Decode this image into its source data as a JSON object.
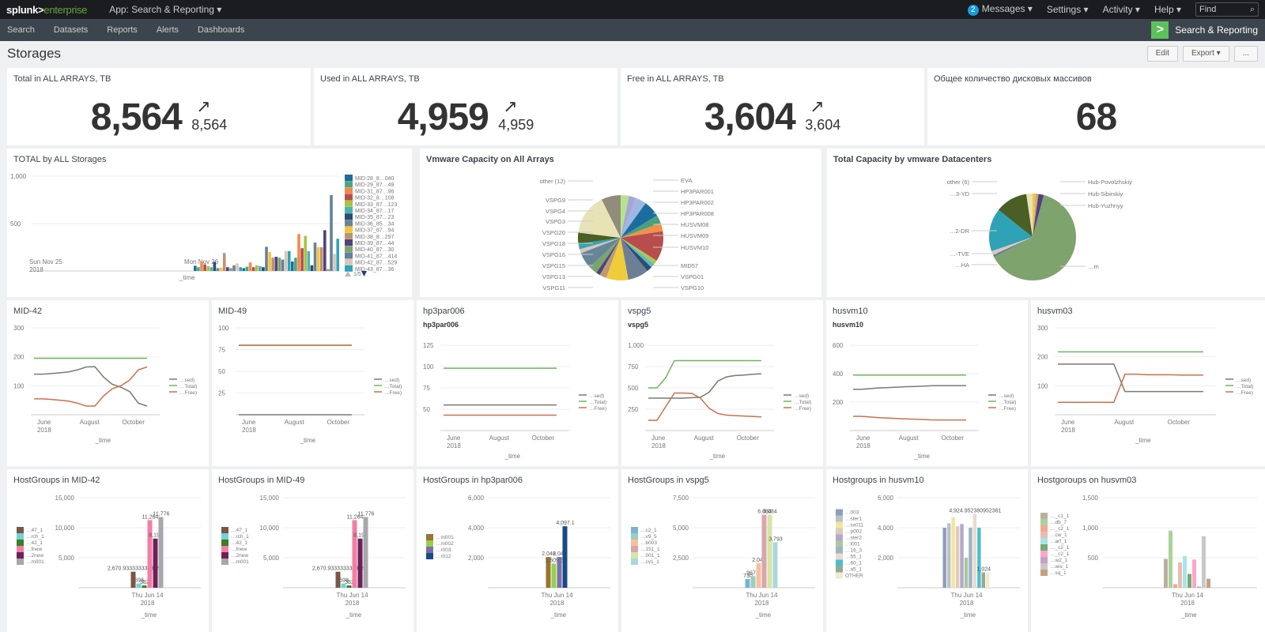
{
  "topbar": {
    "logo_a": "splunk>",
    "logo_b": "enterprise",
    "app_menu": "App: Search & Reporting ▾",
    "messages_count": "2",
    "messages": "Messages ▾",
    "settings": "Settings ▾",
    "activity": "Activity ▾",
    "help": "Help ▾",
    "find_placeholder": "Find",
    "find_icon": "search-icon"
  },
  "nav": {
    "items": [
      "Search",
      "Datasets",
      "Reports",
      "Alerts",
      "Dashboards"
    ],
    "app_title": "Search & Reporting",
    "app_icon": ">"
  },
  "page": {
    "title": "Storages",
    "edit": "Edit",
    "export": "Export ▾",
    "more": "..."
  },
  "singles": [
    {
      "title": "Total in ALL ARRAYS, TB",
      "value": "8,564",
      "delta": "8,564",
      "trend": "↗"
    },
    {
      "title": "Used in ALL ARRAYS, TB",
      "value": "4,959",
      "delta": "4,959",
      "trend": "↗"
    },
    {
      "title": "Free in ALL ARRAYS, TB",
      "value": "3,604",
      "delta": "3,604",
      "trend": "↗"
    },
    {
      "title": "Общее количество дисковых массивов",
      "value": "68"
    }
  ],
  "chart_data": [
    {
      "id": "total-by-all",
      "type": "bar",
      "title": "TOTAL by ALL Storages",
      "xlabel": "_time",
      "ylim": [
        0,
        1000
      ],
      "yticks": [
        "1,000",
        "500"
      ],
      "xticks": [
        "Sun Nov 25\n2018",
        "Mon Nov 26"
      ],
      "legend": [
        "MID-28_8…040",
        "MID-29_87…49",
        "MID-31_87…96",
        "MID-32_8…108",
        "MID-33_87…123",
        "MID-34_87…17",
        "MID-35_87…23",
        "MID-36_85…34",
        "MID-37_87…94",
        "MID-38_8…297",
        "MID-39_87…44",
        "MID-40_87…30",
        "MID-41_87…414",
        "MID-42_87…529",
        "MID-43_87…36"
      ],
      "legend_page": "1/5",
      "colors": [
        "#1e6c98",
        "#4ea584",
        "#ef8c4c",
        "#b64d4f",
        "#a8c43d",
        "#4eb3b6",
        "#294e70",
        "#6b8294",
        "#f2c73d",
        "#b99470",
        "#55407e",
        "#7ea36d",
        "#63819a",
        "#d9c8b8",
        "#2fa3b6"
      ],
      "values": [
        55,
        40,
        100,
        70,
        50,
        40,
        95,
        30,
        35,
        190,
        40,
        30,
        60,
        80,
        40,
        30,
        45,
        90,
        40,
        60,
        50,
        40,
        255,
        200,
        140,
        150,
        140,
        120,
        210,
        210,
        100,
        140,
        390,
        240,
        370,
        210,
        60,
        300,
        250,
        250,
        430,
        20,
        800,
        180,
        340
      ]
    },
    {
      "id": "vmware-capacity",
      "type": "pie",
      "title": "Vmware Capacity on All Arrays",
      "labels": [
        "EVA",
        "HP3PAR001",
        "HP3PAR002",
        "HP3PAR008",
        "HUSVM08",
        "HUSVM09",
        "HUSVM10",
        "MID57",
        "VSPG01",
        "VSPG10",
        "VSPG11",
        "VSPG13",
        "VSPG15",
        "VSPG16",
        "VSPG18",
        "VSPG20",
        "VSPG3",
        "VSPG4",
        "VSPG9",
        "other (12)"
      ],
      "values": [
        3,
        2.5,
        4,
        6,
        3,
        3,
        11,
        1.5,
        1.5,
        2,
        7.5,
        8,
        2.5,
        1.5,
        3,
        6,
        1.5,
        2,
        4,
        15,
        7
      ],
      "colors": [
        "#b7e28d",
        "#a6a6d6",
        "#9fb8e3",
        "#1b6da0",
        "#47a17e",
        "#ef9149",
        "#b84d4e",
        "#a9c94f",
        "#5fb8c4",
        "#2e4e6f",
        "#6c7f95",
        "#f0cb3c",
        "#bc9b72",
        "#56407e",
        "#79a56f",
        "#678599",
        "#d8c7b6",
        "#33a5b7",
        "#4a5f23",
        "#e8e2b7",
        "#918d7a"
      ]
    },
    {
      "id": "datacenters",
      "type": "pie",
      "title": "Total Capacity by vmware Datacenters",
      "labels": [
        "Hub-Povolzhskiy",
        "Hub-Sibirskiy",
        "Hub-Yuzhnyy",
        "…m",
        "…HA",
        "…-TVE",
        "…2-DR",
        "…3-YD",
        "other (6)"
      ],
      "values": [
        1.2,
        1,
        2,
        63,
        1,
        1.5,
        16,
        12,
        2.3
      ],
      "colors": [
        "#f2c73d",
        "#c9a77c",
        "#55407e",
        "#7ea36d",
        "#6b8294",
        "#d9c8b8",
        "#2fa3b6",
        "#4a5f23",
        "#e8e2b7"
      ]
    },
    {
      "id": "mid-42",
      "type": "line",
      "title": "MID-42",
      "ylim": [
        0,
        300
      ],
      "yticks": [
        100,
        200,
        300
      ],
      "xticks": [
        "June\n2018",
        "August",
        "October"
      ],
      "xlabel": "_time",
      "series": [
        {
          "name": "…sed)",
          "color": "#777c6d",
          "values": [
            140,
            140,
            142,
            145,
            148,
            155,
            165,
            166,
            130,
            105,
            95,
            80,
            40,
            30
          ]
        },
        {
          "name": "…Total)",
          "color": "#6fb55a",
          "values": [
            195,
            195,
            195,
            195,
            195,
            195,
            195,
            195,
            195,
            195,
            195,
            195,
            195,
            195
          ]
        },
        {
          "name": "…Free)",
          "color": "#c9704e",
          "values": [
            55,
            55,
            53,
            50,
            47,
            40,
            30,
            30,
            65,
            90,
            100,
            120,
            155,
            165
          ]
        }
      ]
    },
    {
      "id": "mid-49",
      "type": "line",
      "title": "MID-49",
      "ylim": [
        0,
        100
      ],
      "yticks": [
        25,
        50,
        75,
        100
      ],
      "xticks": [
        "June\n2018",
        "August",
        "October"
      ],
      "xlabel": "_time",
      "series": [
        {
          "name": "…sed)",
          "color": "#777c6d",
          "values": [
            0,
            0,
            0,
            0,
            0,
            0,
            0,
            0,
            0,
            0,
            0,
            0,
            0,
            0
          ]
        },
        {
          "name": "…Total)",
          "color": "#6fb55a",
          "values": [
            80,
            80,
            80,
            80,
            80,
            80,
            80,
            80,
            80,
            80,
            80,
            80,
            80,
            80
          ]
        },
        {
          "name": "…Free)",
          "color": "#c9704e",
          "values": [
            80,
            80,
            80,
            80,
            80,
            80,
            80,
            80,
            80,
            80,
            80,
            80,
            80,
            80
          ]
        }
      ]
    },
    {
      "id": "hp3par006",
      "type": "line",
      "title": "hp3par006",
      "subtitle": "hp3par006",
      "ylim": [
        25,
        125
      ],
      "yticks": [
        50,
        75,
        100,
        125
      ],
      "xticks": [
        "June\n2018",
        "August",
        "October"
      ],
      "xlabel": "_time",
      "series": [
        {
          "name": "…sed)",
          "color": "#777c6d",
          "values": [
            55,
            55,
            55,
            55,
            55,
            55,
            55,
            55,
            55,
            55,
            55,
            55,
            55,
            55
          ]
        },
        {
          "name": "…Total)",
          "color": "#6fb55a",
          "values": [
            98,
            98,
            98,
            98,
            98,
            98,
            98,
            98,
            98,
            98,
            98,
            98,
            98,
            98
          ]
        },
        {
          "name": "…Free)",
          "color": "#c9704e",
          "values": [
            43,
            43,
            43,
            43,
            43,
            43,
            43,
            43,
            43,
            43,
            43,
            43,
            43,
            43
          ]
        }
      ]
    },
    {
      "id": "vspg5",
      "type": "line",
      "title": "vspg5",
      "subtitle": "vspg5",
      "ylim": [
        0,
        1000
      ],
      "yticks": [
        "250",
        "500",
        "750",
        "1,000"
      ],
      "xticks": [
        "June\n2018",
        "August",
        "October"
      ],
      "xlabel": "_time",
      "series": [
        {
          "name": "…sed)",
          "color": "#777c6d",
          "values": [
            380,
            380,
            380,
            380,
            380,
            385,
            390,
            450,
            580,
            630,
            645,
            650,
            660,
            665
          ]
        },
        {
          "name": "…Total)",
          "color": "#6fb55a",
          "values": [
            500,
            500,
            620,
            820,
            820,
            820,
            820,
            820,
            820,
            820,
            820,
            820,
            820,
            820
          ]
        },
        {
          "name": "…Free)",
          "color": "#c9704e",
          "values": [
            120,
            120,
            280,
            440,
            440,
            435,
            380,
            260,
            200,
            180,
            175,
            170,
            165,
            160
          ]
        }
      ]
    },
    {
      "id": "husvm10",
      "type": "line",
      "title": "husvm10",
      "subtitle": "husvm10",
      "ylim": [
        0,
        600
      ],
      "yticks": [
        200,
        400,
        600
      ],
      "xticks": [
        "June\n2018",
        "August",
        "October"
      ],
      "xlabel": "_time",
      "series": [
        {
          "name": "…sed)",
          "color": "#777c6d",
          "values": [
            290,
            290,
            295,
            300,
            302,
            305,
            308,
            310,
            312,
            315,
            316,
            316,
            316,
            316
          ]
        },
        {
          "name": "…Total)",
          "color": "#6fb55a",
          "values": [
            390,
            390,
            390,
            390,
            390,
            390,
            390,
            390,
            390,
            390,
            390,
            390,
            390,
            390
          ]
        },
        {
          "name": "…Free)",
          "color": "#c9704e",
          "values": [
            100,
            100,
            95,
            90,
            88,
            85,
            82,
            80,
            78,
            75,
            74,
            74,
            74,
            74
          ]
        }
      ]
    },
    {
      "id": "husvm03",
      "type": "line",
      "title": "husvm03",
      "ylim": [
        0,
        300
      ],
      "yticks": [
        100,
        200,
        300
      ],
      "xticks": [
        "June\n2018",
        "August",
        "October"
      ],
      "xlabel": "_time",
      "series": [
        {
          "name": "…sed)",
          "color": "#777c6d",
          "values": [
            175,
            175,
            175,
            175,
            175,
            175,
            80,
            80,
            80,
            80,
            80,
            80,
            80,
            80
          ]
        },
        {
          "name": "…Total)",
          "color": "#6fb55a",
          "values": [
            217,
            217,
            217,
            217,
            217,
            217,
            217,
            217,
            217,
            217,
            217,
            217,
            217,
            217
          ]
        },
        {
          "name": "…Free)",
          "color": "#c9704e",
          "values": [
            43,
            43,
            43,
            43,
            43,
            43,
            140,
            140,
            138,
            138,
            138,
            137,
            137,
            137
          ]
        }
      ]
    },
    {
      "id": "hg-mid-42",
      "type": "bar",
      "title": "HostGroups in MID-42",
      "ylim": [
        0,
        15000
      ],
      "yticks": [
        "5,000",
        "10,000",
        "15,000"
      ],
      "xtick": "Thu Jun 14\n2018",
      "xlabel": "_time",
      "legend": [
        "…47_1",
        "…rch_1",
        "…42_1",
        "…fnew",
        "…2new",
        "…m001"
      ],
      "colors": [
        "#7b5546",
        "#6fd4d4",
        "#3c7d28",
        "#f27fa3",
        "#6d2157",
        "#a6a8ab"
      ],
      "values": [
        2670.93,
        698,
        382,
        11264,
        8192,
        11776
      ],
      "labels": [
        "2,670.933333333334",
        "698",
        "382",
        "11,264",
        "8,192",
        "11,776"
      ]
    },
    {
      "id": "hg-mid-49",
      "type": "bar",
      "title": "HostGroups in MID-49",
      "ylim": [
        0,
        15000
      ],
      "yticks": [
        "5,000",
        "10,000",
        "15,000"
      ],
      "xtick": "Thu Jun 14\n2018",
      "xlabel": "_time",
      "legend": [
        "…47_1",
        "…rch_1",
        "…42_1",
        "…fnew",
        "…2new",
        "…m001"
      ],
      "colors": [
        "#7b5546",
        "#6fd4d4",
        "#3c7d28",
        "#f27fa3",
        "#6d2157",
        "#a6a8ab"
      ],
      "values": [
        2670.93,
        698,
        382,
        11264,
        8192,
        11776
      ],
      "labels": [
        "2,670.933333333334",
        "698",
        "382",
        "11,264",
        "8,192",
        "11,776"
      ]
    },
    {
      "id": "hg-hp3par006",
      "type": "bar",
      "title": "HostGroups in hp3par006",
      "ylim": [
        0,
        6000
      ],
      "yticks": [
        "2,000",
        "4,000",
        "6,000"
      ],
      "xtick": "Thu Jun 14\n2018",
      "xlabel": "_time",
      "legend": [
        "…m001",
        "…m002",
        "…r003",
        "…r012"
      ],
      "colors": [
        "#9a7331",
        "#95cf4b",
        "#7b70a6",
        "#1a4a85"
      ],
      "values": [
        2048,
        1609.8,
        2048,
        4097.1
      ],
      "labels": [
        "2,048",
        "1,609.8",
        "2,048",
        "4,097.1"
      ]
    },
    {
      "id": "hg-vspg5",
      "type": "bar",
      "title": "HostGroups in vspg5",
      "ylim": [
        0,
        7500
      ],
      "yticks": [
        "2,500",
        "5,000",
        "7,500"
      ],
      "xtick": "Thu Jun 14\n2018",
      "xlabel": "_time",
      "legend": [
        "…c2_1",
        "…v9_5",
        "…b003",
        "…151_1",
        "…001_1",
        "…cv1_1"
      ],
      "colors": [
        "#7ab3d1",
        "#97cfc2",
        "#f5c0a0",
        "#d9a5ac",
        "#d8e3a5",
        "#a8d9dc"
      ],
      "values": [
        730,
        967.9,
        2048,
        6084,
        6084,
        3793
      ],
      "labels": [
        "730",
        "967.9",
        "2,048",
        "6,084",
        "6,084",
        "3,793"
      ]
    },
    {
      "id": "hg-husvm10",
      "type": "bar",
      "title": "Hostgroups in husvm10",
      "ylim": [
        0,
        6000
      ],
      "yticks": [
        "2,000",
        "4,000",
        "6,000"
      ],
      "xtick": "Thu Jun 14\n2018",
      "xlabel": "_time",
      "legend": [
        "…003",
        "…ster1",
        "…sx011",
        "…p002",
        "…ster2",
        "…l001",
        "…16_3",
        "…55_1",
        "…60_1",
        "…a5_1",
        "OTHER"
      ],
      "colors": [
        "#8c9fb7",
        "#b8c2cc",
        "#f5e49a",
        "#e0cbb9",
        "#b3a8cc",
        "#a8c7a0",
        "#9fb3c7",
        "#e8dbd0",
        "#4bbfcc",
        "#9ca88c",
        "#f0ead0"
      ],
      "values": [
        4000,
        4300,
        4700,
        4100,
        4250,
        2000,
        4000,
        4925,
        4000,
        1024,
        1024
      ],
      "labels": [
        "",
        "",
        "",
        "",
        "",
        "",
        "",
        "4,924.952380952381",
        "",
        "1,024",
        ""
      ]
    },
    {
      "id": "hg-husvm03",
      "type": "bar",
      "title": "Hostgoroups on husvm03",
      "ylim": [
        0,
        1500
      ],
      "yticks": [
        "500",
        "1,000",
        "1,500"
      ],
      "xtick": "Thu Jun 14\n2018",
      "xlabel": "_time",
      "legend": [
        "…_c1_1",
        "…db_7",
        "…_c2_1",
        "…cw_1",
        "…arf_1",
        "…_c2_1",
        "…_c2_1",
        "…w2_1",
        "…wis_1",
        "…sq_1"
      ],
      "colors": [
        "#b8b0a0",
        "#a8d39a",
        "#f0a898",
        "#e8bcb0",
        "#a8e4e8",
        "#7aa870",
        "#f8a8c8",
        "#c8a0c8",
        "#c8c8c8",
        "#c8a080"
      ],
      "values": [
        480,
        950,
        60,
        420,
        530,
        230,
        470,
        20,
        860,
        150
      ],
      "labels": [
        "",
        "",
        "",
        "",
        "",
        "",
        "",
        "",
        "",
        ""
      ]
    }
  ]
}
